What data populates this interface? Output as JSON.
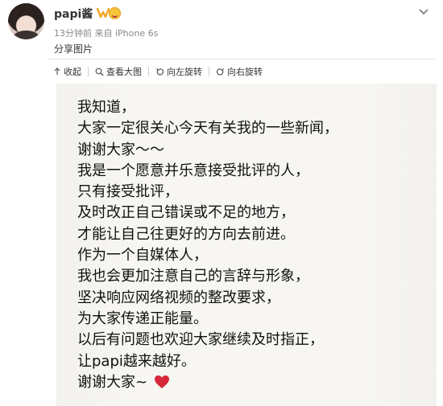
{
  "header": {
    "username": "papi酱",
    "meta": "13分钟前 来自 iPhone 6s",
    "post_text": "分享图片"
  },
  "toolbar": {
    "items": [
      {
        "label": "收起",
        "icon": "arrow-up-icon"
      },
      {
        "label": "查看大图",
        "icon": "magnify-icon"
      },
      {
        "label": "向左旋转",
        "icon": "rotate-left-icon"
      },
      {
        "label": "向右旋转",
        "icon": "rotate-right-icon"
      }
    ]
  },
  "image": {
    "lines": [
      "我知道，",
      "大家一定很关心今天有关我的一些新闻，",
      "谢谢大家～～",
      "我是一个愿意并乐意接受批评的人，",
      "只有接受批评，",
      "及时改正自己错误或不足的地方，",
      "才能让自己往更好的方向去前进。",
      "作为一个自媒体人，",
      "我也会更加注意自己的言辞与形象，",
      "坚决响应网络视频的整改要求，",
      "为大家传递正能量。",
      "以后有问题也欢迎大家继续及时指正，",
      "让papi越来越好。",
      "谢谢大家~"
    ],
    "heart_color": "#d6283a"
  },
  "colors": {
    "accent": "#f5a623",
    "text": "#333333",
    "muted": "#888888"
  }
}
